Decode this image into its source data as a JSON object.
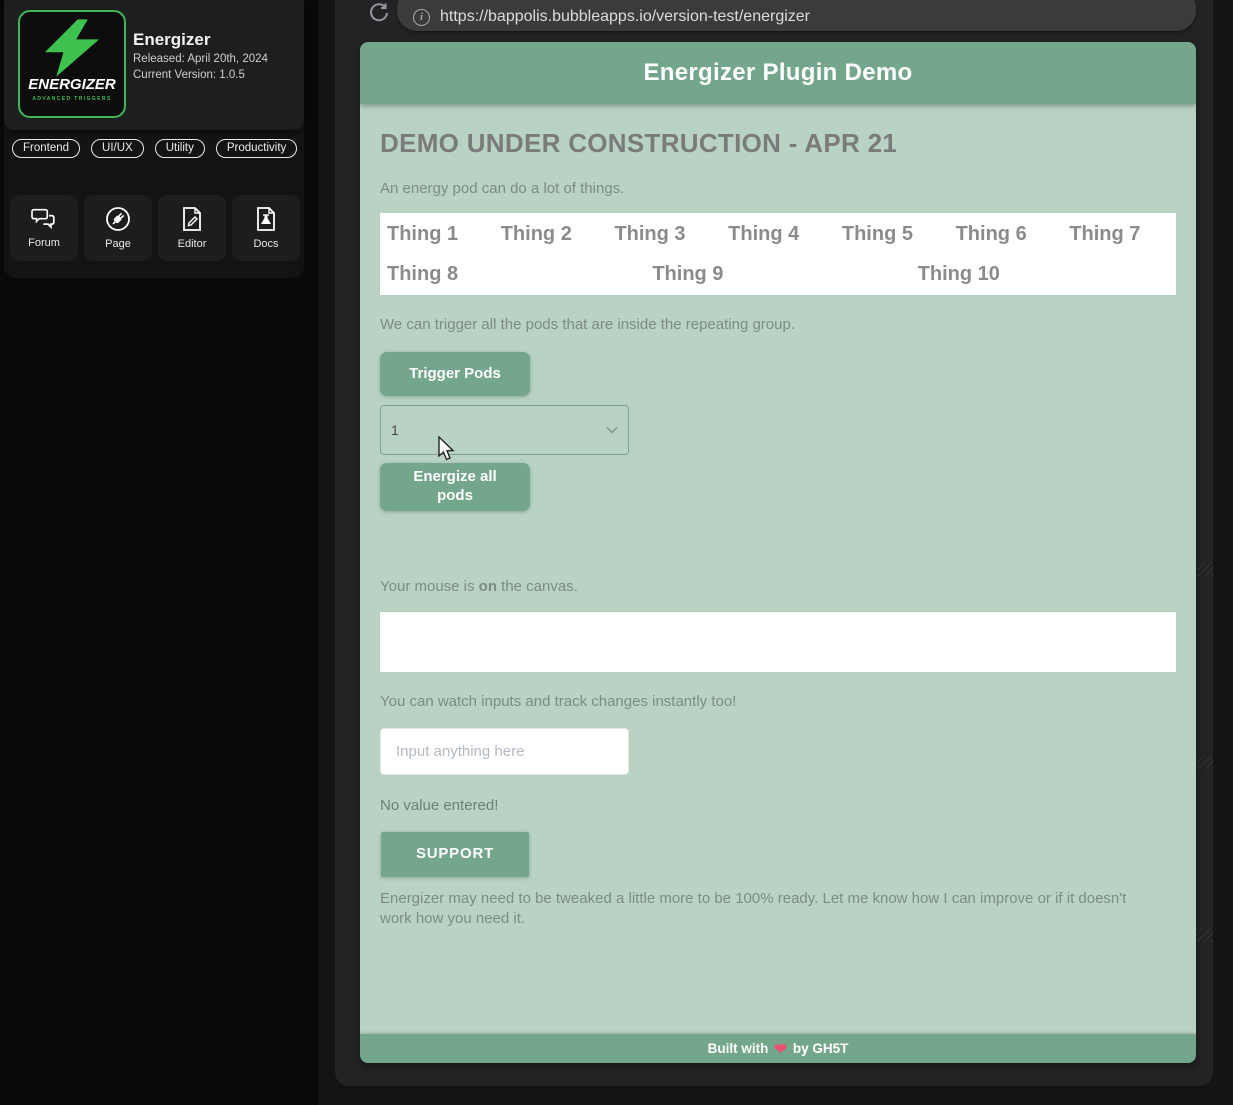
{
  "sidebar": {
    "logo": {
      "brand": "ENERGIZER",
      "sub": "ADVANCED TRIGGERS"
    },
    "title": "Energizer",
    "released": "Released: April 20th, 2024",
    "version": "Current Version: 1.0.5",
    "tags": [
      "Frontend",
      "UI/UX",
      "Utility",
      "Productivity"
    ],
    "nav": [
      {
        "icon": "forum-icon",
        "label": "Forum"
      },
      {
        "icon": "plug-icon",
        "label": "Page"
      },
      {
        "icon": "editor-icon",
        "label": "Editor"
      },
      {
        "icon": "docs-icon",
        "label": "Docs"
      }
    ]
  },
  "browser": {
    "url": "https://bappolis.bubbleapps.io/version-test/energizer"
  },
  "demo": {
    "header_title": "Energizer Plugin Demo",
    "heading": "DEMO UNDER CONSTRUCTION - APR 21",
    "intro": "An energy pod can do a lot of things.",
    "things_row1": [
      "Thing 1",
      "Thing 2",
      "Thing 3",
      "Thing 4",
      "Thing 5",
      "Thing 6",
      "Thing 7"
    ],
    "things_row2": [
      "Thing 8",
      "Thing 9",
      "Thing 10"
    ],
    "trigger_text": "We can trigger all the pods that are inside the repeating group.",
    "trigger_button": "Trigger Pods",
    "dropdown_value": "1",
    "energize_button": "Energize all pods",
    "mouse_prefix": "Your mouse is ",
    "mouse_state": "on",
    "mouse_suffix": " the canvas.",
    "inputs_text": "You can watch inputs and track changes instantly too!",
    "input_placeholder": "Input anything here",
    "no_value_text": "No value entered!",
    "support_button": "SUPPORT",
    "note": "Energizer may need to be tweaked a little more to be 100% ready. Let me know how I can improve or if it doesn't work how you need it.",
    "footer_built": "Built with",
    "footer_heart": "❤",
    "footer_by": "by GH5T"
  },
  "colors": {
    "accent_green": "#73a68a",
    "body_green": "#b8d3c4",
    "logo_green": "#3db952",
    "heart_pink": "#ee4f70",
    "panel_dark": "#232325",
    "sidebar_dark": "#131315"
  }
}
